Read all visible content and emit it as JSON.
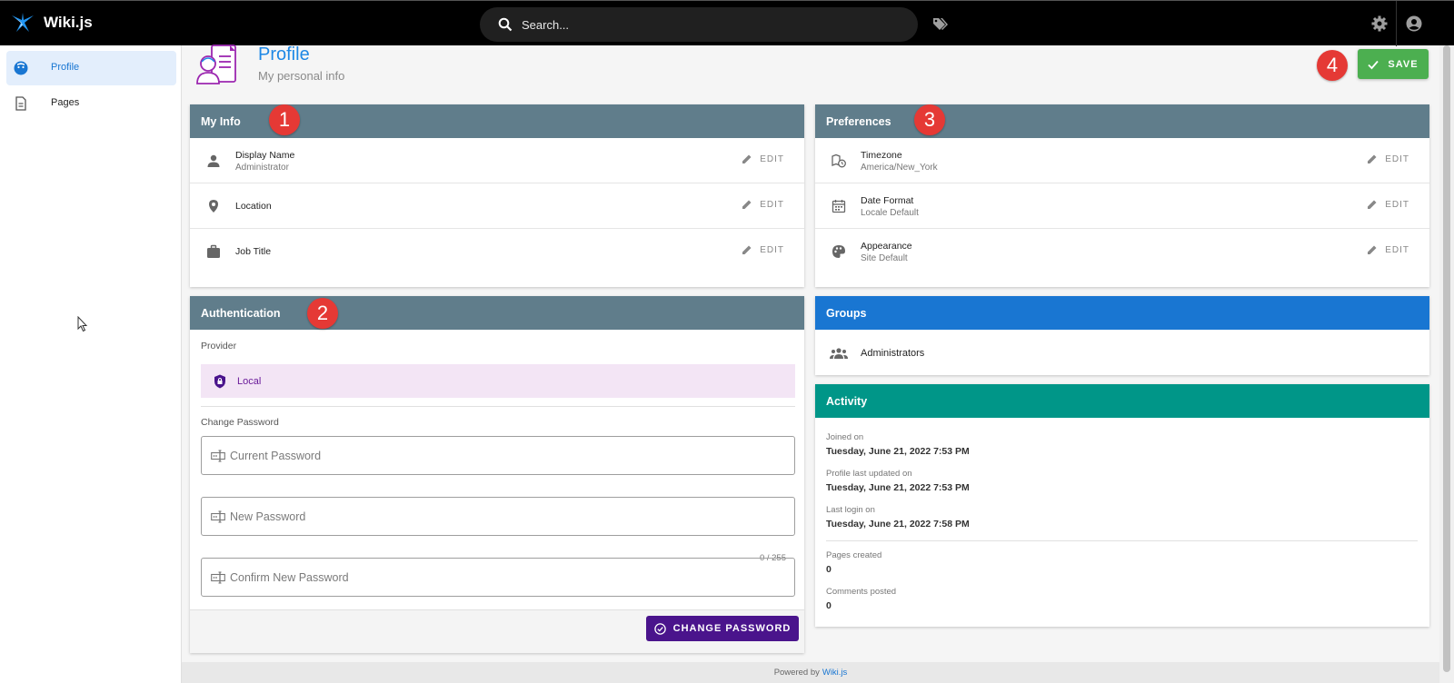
{
  "app": {
    "name": "Wiki.js"
  },
  "search": {
    "placeholder": "Search..."
  },
  "sidebar": {
    "items": [
      {
        "label": "Profile",
        "icon": "profile-icon",
        "active": true
      },
      {
        "label": "Pages",
        "icon": "page-icon",
        "active": false
      }
    ]
  },
  "header": {
    "title": "Profile",
    "subtitle": "My personal info",
    "save_label": "SAVE"
  },
  "badges": [
    "1",
    "2",
    "3",
    "4"
  ],
  "my_info": {
    "title": "My Info",
    "rows": [
      {
        "label": "Display Name",
        "value": "Administrator",
        "edit": "EDIT"
      },
      {
        "label": "Location",
        "value": "",
        "edit": "EDIT"
      },
      {
        "label": "Job Title",
        "value": "",
        "edit": "EDIT"
      }
    ]
  },
  "preferences": {
    "title": "Preferences",
    "rows": [
      {
        "label": "Timezone",
        "value": "America/New_York",
        "edit": "EDIT"
      },
      {
        "label": "Date Format",
        "value": "Locale Default",
        "edit": "EDIT"
      },
      {
        "label": "Appearance",
        "value": "Site Default",
        "edit": "EDIT"
      }
    ]
  },
  "authentication": {
    "title": "Authentication",
    "provider_label": "Provider",
    "provider": "Local",
    "change_password_label": "Change Password",
    "current_password_placeholder": "Current Password",
    "new_password_placeholder": "New Password",
    "new_password_counter": "0 / 255",
    "confirm_password_placeholder": "Confirm New Password",
    "change_password_button": "CHANGE PASSWORD"
  },
  "groups": {
    "title": "Groups",
    "items": [
      "Administrators"
    ]
  },
  "activity": {
    "title": "Activity",
    "joined_label": "Joined on",
    "joined_value": "Tuesday, June 21, 2022 7:53 PM",
    "updated_label": "Profile last updated on",
    "updated_value": "Tuesday, June 21, 2022 7:53 PM",
    "login_label": "Last login on",
    "login_value": "Tuesday, June 21, 2022 7:58 PM",
    "pages_label": "Pages created",
    "pages_value": "0",
    "comments_label": "Comments posted",
    "comments_value": "0"
  },
  "footer": {
    "prefix": "Powered by",
    "link": "Wiki.js"
  },
  "colors": {
    "accent": "#1976d2",
    "card_header": "#607d8b",
    "groups_header": "#1976d2",
    "activity_header": "#009688",
    "save": "#4caf50",
    "change_password": "#4a148c",
    "badge": "#e53935"
  }
}
